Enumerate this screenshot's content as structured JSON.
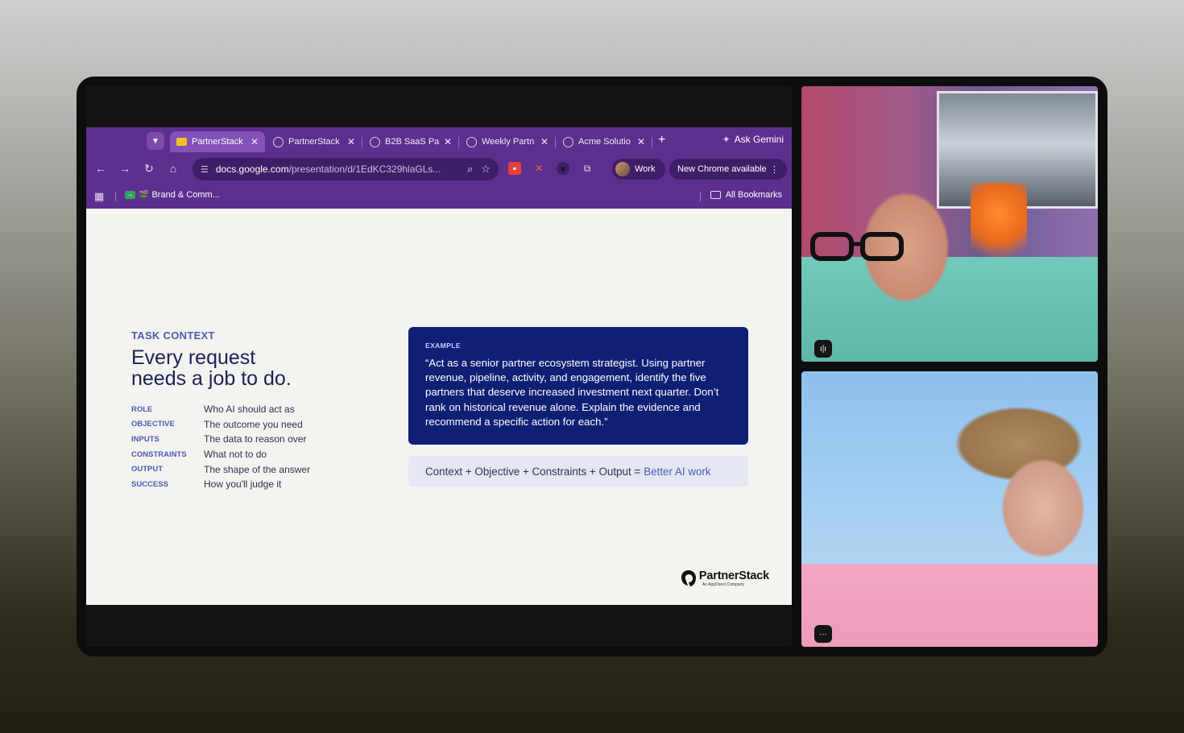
{
  "browser": {
    "tabs": [
      {
        "label": "PartnerStack",
        "active": true,
        "favicon": "slides-icon"
      },
      {
        "label": "PartnerStack",
        "active": false,
        "favicon": "globe-icon"
      },
      {
        "label": "B2B SaaS Pa",
        "active": false,
        "favicon": "globe-icon"
      },
      {
        "label": "Weekly Partn",
        "active": false,
        "favicon": "globe-icon"
      },
      {
        "label": "Acme Solutio",
        "active": false,
        "favicon": "globe-icon"
      }
    ],
    "ask_gemini": "Ask Gemini",
    "url_host": "docs.google.com",
    "url_path": "/presentation/d/1EdKC329hlaGLs...",
    "profile": "Work",
    "update_label": "New Chrome available",
    "bookmark_folder": "Brand & Comm...",
    "all_bookmarks": "All Bookmarks",
    "accent_color": "#5c2f8e"
  },
  "slide": {
    "section_label": "TASK CONTEXT",
    "title_line1": "Every request",
    "title_line2": "needs a job to do.",
    "rows": [
      {
        "key": "ROLE",
        "desc": "Who AI should act as"
      },
      {
        "key": "OBJECTIVE",
        "desc": "The outcome you need"
      },
      {
        "key": "INPUTS",
        "desc": "The data to reason over"
      },
      {
        "key": "CONSTRAINTS",
        "desc": "What not to do"
      },
      {
        "key": "OUTPUT",
        "desc": "The shape of the answer"
      },
      {
        "key": "SUCCESS",
        "desc": "How you'll judge it"
      }
    ],
    "example_label": "EXAMPLE",
    "example_text": "“Act as a senior partner ecosystem strategist. Using partner revenue, pipeline, activity, and engagement, identify the five partners that deserve increased investment next quarter. Don’t rank on historical revenue alone. Explain the evidence and recommend a specific action for each.”",
    "formula": "Context + Objective + Constraints + Output =",
    "formula_result": "Better AI work",
    "logo_name": "PartnerStack",
    "logo_sub": "An AppDirect Company",
    "accent_color": "#0f1f74"
  }
}
